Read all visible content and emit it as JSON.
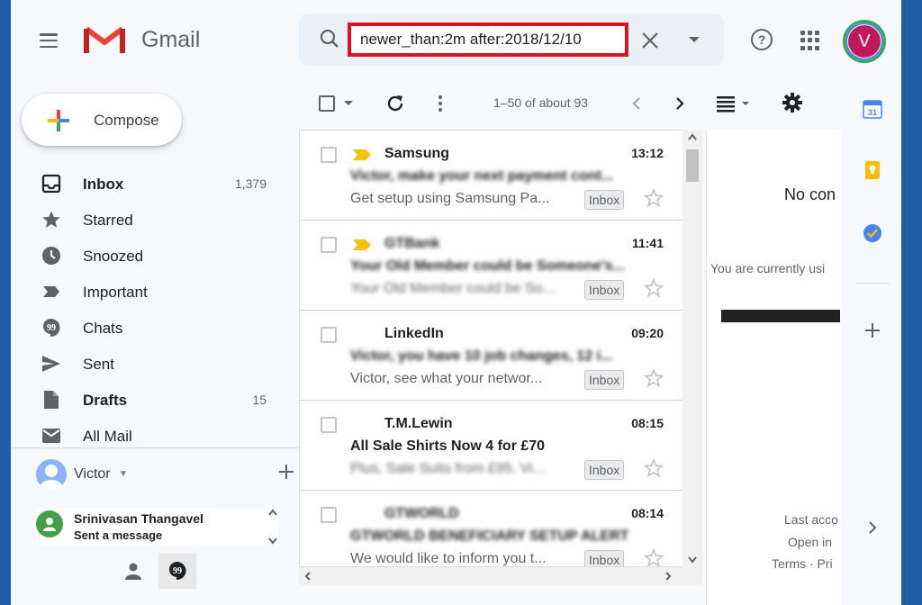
{
  "header": {
    "brand": "Gmail",
    "search_value": "newer_than:2m after:2018/12/10",
    "avatar_letter": "V"
  },
  "compose_label": "Compose",
  "nav": [
    {
      "label": "Inbox",
      "count": "1,379",
      "bold": true,
      "icon": "inbox-icon"
    },
    {
      "label": "Starred",
      "count": "",
      "bold": false,
      "icon": "star-icon"
    },
    {
      "label": "Snoozed",
      "count": "",
      "bold": false,
      "icon": "clock-icon"
    },
    {
      "label": "Important",
      "count": "",
      "bold": false,
      "icon": "important-icon"
    },
    {
      "label": "Chats",
      "count": "",
      "bold": false,
      "icon": "chat-icon"
    },
    {
      "label": "Sent",
      "count": "",
      "bold": false,
      "icon": "send-icon"
    },
    {
      "label": "Drafts",
      "count": "15",
      "bold": true,
      "icon": "draft-icon"
    },
    {
      "label": "All Mail",
      "count": "",
      "bold": false,
      "icon": "mail-icon"
    }
  ],
  "hangouts": {
    "user": "Victor",
    "contact_name": "Srinivasan Thangavel",
    "contact_status": "Sent a message"
  },
  "toolbar": {
    "count": "1–50 of about 93"
  },
  "emails": [
    {
      "sender": "Samsung",
      "time": "13:12",
      "subject": "Victor, make your next payment cont...",
      "snippet": "Get setup using Samsung Pa...",
      "label": "Inbox",
      "important": true,
      "subject_bold": true,
      "blur_sender": false,
      "blur_subject": true,
      "blur_snippet": false
    },
    {
      "sender": "GTBank",
      "time": "11:41",
      "subject": "Your Old Member could be Someone's...",
      "snippet": "Your Old Member could be So...",
      "label": "Inbox",
      "important": true,
      "subject_bold": true,
      "blur_sender": true,
      "blur_subject": true,
      "blur_snippet": true
    },
    {
      "sender": "LinkedIn",
      "time": "09:20",
      "subject": "Victor, you have 10 job changes, 12 i...",
      "snippet": "Victor, see what your networ...",
      "label": "Inbox",
      "important": false,
      "subject_bold": true,
      "blur_sender": false,
      "blur_subject": true,
      "blur_snippet": false
    },
    {
      "sender": "T.M.Lewin",
      "time": "08:15",
      "subject": "All Sale Shirts Now 4 for £70",
      "snippet": "Plus, Sale Suits from £95. Vi...",
      "label": "Inbox",
      "important": false,
      "subject_bold": true,
      "blur_sender": false,
      "blur_subject": false,
      "blur_snippet": true
    },
    {
      "sender": "GTWORLD",
      "time": "08:14",
      "subject": "GTWORLD BENEFICIARY SETUP ALERT",
      "snippet": "We would like to inform you t...",
      "label": "Inbox",
      "important": false,
      "subject_bold": true,
      "blur_sender": true,
      "blur_subject": true,
      "blur_snippet": false
    }
  ],
  "reading_pane": {
    "title": "No con",
    "subtitle": "You are currently usi",
    "last_activity": "Last acco",
    "open_in": "Open in",
    "terms": "Terms · Pri"
  },
  "colors": {
    "accent_red": "#e0101c",
    "avatar_bg": "#c2185b",
    "important_yellow": "#f4c20d"
  }
}
